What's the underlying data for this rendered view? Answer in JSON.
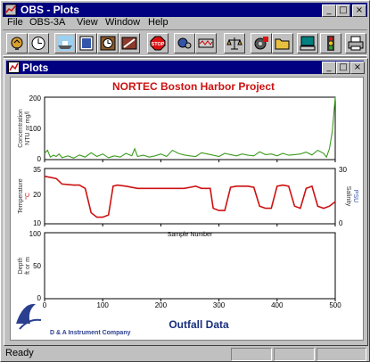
{
  "app": {
    "title": "OBS - Plots"
  },
  "window_buttons": {
    "minimize": "_",
    "maximize": "□",
    "close": "×"
  },
  "menu": [
    {
      "label": "File"
    },
    {
      "label": "OBS-3A"
    },
    {
      "label": "View"
    },
    {
      "label": "Window"
    },
    {
      "label": "Help"
    }
  ],
  "toolbar": {
    "icons": [
      "connect-icon",
      "clock-icon",
      "ship-icon",
      "panel-icon",
      "timer-icon",
      "calibrate-icon",
      "stop-icon",
      "settings-icon",
      "data-icon",
      "balance-icon",
      "disk-icon",
      "open-folder-icon",
      "computer-icon",
      "traffic-light-icon",
      "printer-icon"
    ],
    "stop_label": "STOP"
  },
  "child": {
    "title": "Plots"
  },
  "chart": {
    "title": "NORTEC Boston Harbor Project",
    "xlabel": "Sample Number",
    "footer": "Outfall Data",
    "company": "D & A Instrument Company",
    "panels": {
      "conc": {
        "ylabel1": "Concentration",
        "ylabel2": "NTU or mg/l",
        "ticks": [
          "200",
          "100",
          "0"
        ]
      },
      "temp": {
        "ylabel1": "Temperature",
        "ylabel2": "°C",
        "ticks": [
          "35",
          "20",
          "10"
        ],
        "rlabel1": "Salinity",
        "rlabel2": "PSU",
        "rticks": [
          "30",
          "0"
        ]
      },
      "depth": {
        "ylabel1": "Depth",
        "ylabel2": "ft or m",
        "ticks": [
          "100",
          "50",
          "0"
        ]
      }
    },
    "xticks": [
      "0",
      "100",
      "200",
      "300",
      "400",
      "500"
    ]
  },
  "chart_data": {
    "type": "line",
    "title": "NORTEC Boston Harbor Project",
    "xlabel": "Sample Number",
    "xlim": [
      0,
      500
    ],
    "series": [
      {
        "name": "Concentration",
        "ylim": [
          0,
          200
        ],
        "color": "#3c9b1e",
        "x": [
          0,
          5,
          10,
          15,
          20,
          25,
          30,
          40,
          50,
          60,
          70,
          80,
          90,
          100,
          110,
          120,
          130,
          140,
          150,
          155,
          160,
          170,
          180,
          190,
          200,
          210,
          220,
          230,
          240,
          250,
          260,
          270,
          280,
          290,
          300,
          310,
          320,
          330,
          340,
          350,
          360,
          370,
          380,
          390,
          400,
          410,
          420,
          430,
          440,
          450,
          460,
          470,
          480,
          485,
          490,
          495,
          500
        ],
        "y": [
          20,
          30,
          8,
          14,
          10,
          18,
          6,
          12,
          5,
          15,
          8,
          22,
          10,
          18,
          6,
          12,
          8,
          20,
          12,
          35,
          10,
          14,
          8,
          12,
          18,
          10,
          30,
          20,
          15,
          12,
          10,
          22,
          18,
          14,
          10,
          20,
          16,
          12,
          18,
          14,
          12,
          25,
          16,
          18,
          12,
          20,
          14,
          16,
          18,
          24,
          15,
          30,
          20,
          8,
          35,
          90,
          200
        ]
      },
      {
        "name": "Temperature",
        "ylim": [
          10,
          35
        ],
        "color": "#cc1111",
        "x": [
          0,
          20,
          30,
          50,
          60,
          70,
          80,
          90,
          100,
          110,
          118,
          125,
          140,
          160,
          200,
          240,
          250,
          260,
          270,
          285,
          290,
          300,
          310,
          320,
          330,
          350,
          360,
          370,
          380,
          390,
          400,
          410,
          420,
          430,
          440,
          450,
          455,
          460,
          470,
          480,
          490,
          500
        ],
        "y": [
          31.5,
          30.5,
          28,
          27.5,
          27.5,
          26,
          15,
          13,
          13,
          14,
          27,
          27.5,
          27,
          26,
          26,
          26,
          26.5,
          27,
          26,
          26,
          17,
          16,
          16,
          26.5,
          27,
          27,
          26.5,
          18,
          17,
          17,
          27,
          27.5,
          27,
          18,
          17,
          26,
          26.5,
          27,
          18,
          17,
          18,
          20
        ]
      },
      {
        "name": "Depth",
        "ylim": [
          0,
          100
        ],
        "x": [],
        "y": []
      }
    ]
  },
  "status": {
    "text": "Ready"
  }
}
